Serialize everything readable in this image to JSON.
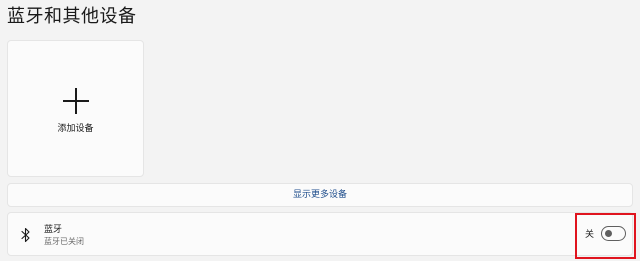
{
  "page": {
    "title": "蓝牙和其他设备"
  },
  "add_device": {
    "label": "添加设备",
    "icon": "plus-icon"
  },
  "show_more": {
    "label": "显示更多设备",
    "color": "#1f4e8c"
  },
  "bluetooth": {
    "icon": "bluetooth-icon",
    "title": "蓝牙",
    "subtitle": "蓝牙已关闭",
    "toggle_state_label": "关",
    "toggle_on": false
  },
  "annotation": {
    "highlight_color": "#e0141e"
  }
}
